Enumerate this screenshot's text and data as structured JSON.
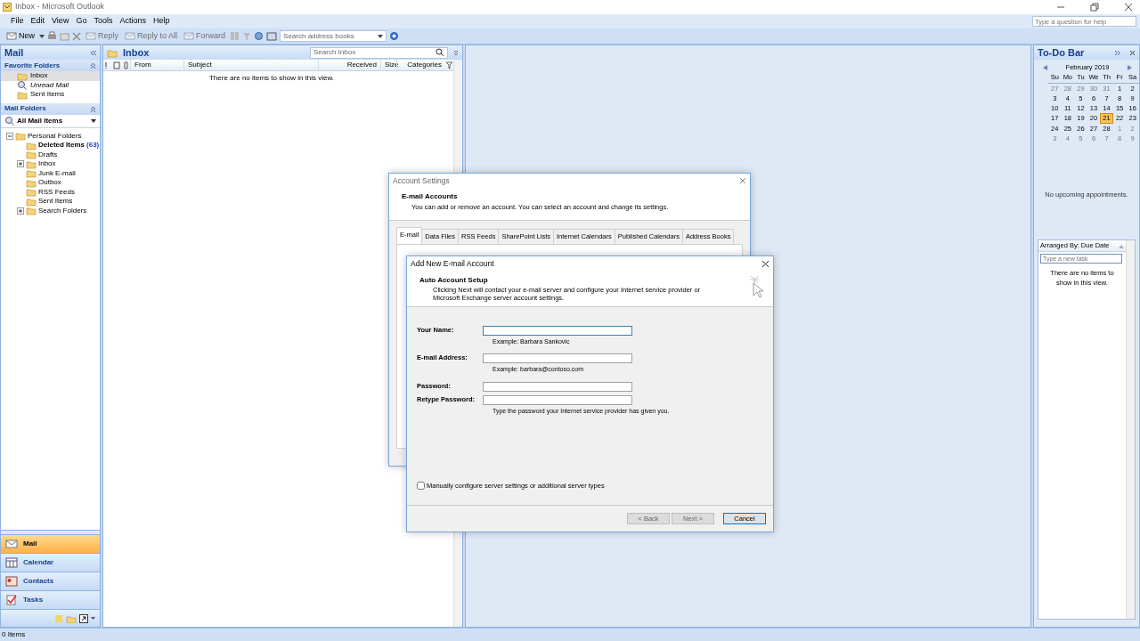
{
  "window": {
    "title": "Inbox - Microsoft Outlook",
    "help_placeholder": "Type a question for help"
  },
  "menu": [
    "File",
    "Edit",
    "View",
    "Go",
    "Tools",
    "Actions",
    "Help"
  ],
  "toolbar": {
    "buttons": [
      {
        "label": "New",
        "disabled": false
      },
      {
        "label": "Reply",
        "disabled": true
      },
      {
        "label": "Reply to All",
        "disabled": true
      },
      {
        "label": "Forward",
        "disabled": true
      }
    ],
    "address_search": "Search address books"
  },
  "nav": {
    "title": "Mail",
    "favorites": {
      "title": "Favorite Folders",
      "items": [
        {
          "label": "Inbox",
          "kind": "folder",
          "selected": true
        },
        {
          "label": "Unread Mail",
          "kind": "search",
          "selected": false
        },
        {
          "label": "Sent Items",
          "kind": "folder",
          "selected": false
        }
      ]
    },
    "mail_folders": {
      "title": "Mail Folders",
      "view": "All Mail Items",
      "tree": [
        {
          "label": "Personal Folders",
          "expanded": true,
          "unread": false,
          "children": [
            {
              "label": "Deleted Items",
              "count": "(63)",
              "unread": true
            },
            {
              "label": "Drafts",
              "unread": false
            },
            {
              "label": "Inbox",
              "expanded": false,
              "unread": false
            },
            {
              "label": "Junk E-mail",
              "unread": false
            },
            {
              "label": "Outbox",
              "unread": false
            },
            {
              "label": "RSS Feeds",
              "unread": false
            },
            {
              "label": "Sent Items",
              "unread": false
            },
            {
              "label": "Search Folders",
              "expanded": false,
              "unread": false
            }
          ]
        }
      ]
    },
    "buttons": [
      {
        "label": "Mail",
        "selected": true
      },
      {
        "label": "Calendar",
        "selected": false
      },
      {
        "label": "Contacts",
        "selected": false
      },
      {
        "label": "Tasks",
        "selected": false
      }
    ]
  },
  "inbox": {
    "title": "Inbox",
    "search_placeholder": "Search Inbox",
    "columns": [
      "From",
      "Subject",
      "Received",
      "Size",
      "Categories"
    ],
    "empty_text": "There are no items to show in this view."
  },
  "todo_bar": {
    "title": "To-Do Bar",
    "calendar": {
      "month": "February 2019",
      "weekdays": [
        "Su",
        "Mo",
        "Tu",
        "We",
        "Th",
        "Fr",
        "Sa"
      ],
      "weeks": [
        [
          {
            "day": "27",
            "other_month": true,
            "selected": false
          },
          {
            "day": "28",
            "other_month": true,
            "selected": false
          },
          {
            "day": "29",
            "other_month": true,
            "selected": false
          },
          {
            "day": "30",
            "other_month": true,
            "selected": false
          },
          {
            "day": "31",
            "other_month": true,
            "selected": false
          },
          {
            "day": "1",
            "other_month": false,
            "selected": false
          },
          {
            "day": "2",
            "other_month": false,
            "selected": false
          }
        ],
        [
          {
            "day": "3",
            "other_month": false,
            "selected": false
          },
          {
            "day": "4",
            "other_month": false,
            "selected": false
          },
          {
            "day": "5",
            "other_month": false,
            "selected": false
          },
          {
            "day": "6",
            "other_month": false,
            "selected": false
          },
          {
            "day": "7",
            "other_month": false,
            "selected": false
          },
          {
            "day": "8",
            "other_month": false,
            "selected": false
          },
          {
            "day": "9",
            "other_month": false,
            "selected": false
          }
        ],
        [
          {
            "day": "10",
            "other_month": false,
            "selected": false
          },
          {
            "day": "11",
            "other_month": false,
            "selected": false
          },
          {
            "day": "12",
            "other_month": false,
            "selected": false
          },
          {
            "day": "13",
            "other_month": false,
            "selected": false
          },
          {
            "day": "14",
            "other_month": false,
            "selected": false
          },
          {
            "day": "15",
            "other_month": false,
            "selected": false
          },
          {
            "day": "16",
            "other_month": false,
            "selected": false
          }
        ],
        [
          {
            "day": "17",
            "other_month": false,
            "selected": false
          },
          {
            "day": "18",
            "other_month": false,
            "selected": false
          },
          {
            "day": "19",
            "other_month": false,
            "selected": false
          },
          {
            "day": "20",
            "other_month": false,
            "selected": false
          },
          {
            "day": "21",
            "other_month": false,
            "selected": true
          },
          {
            "day": "22",
            "other_month": false,
            "selected": false
          },
          {
            "day": "23",
            "other_month": false,
            "selected": false
          }
        ],
        [
          {
            "day": "24",
            "other_month": false,
            "selected": false
          },
          {
            "day": "25",
            "other_month": false,
            "selected": false
          },
          {
            "day": "26",
            "other_month": false,
            "selected": false
          },
          {
            "day": "27",
            "other_month": false,
            "selected": false
          },
          {
            "day": "28",
            "other_month": false,
            "selected": false
          },
          {
            "day": "1",
            "other_month": true,
            "selected": false
          },
          {
            "day": "2",
            "other_month": true,
            "selected": false
          }
        ],
        [
          {
            "day": "3",
            "other_month": true,
            "selected": false
          },
          {
            "day": "4",
            "other_month": true,
            "selected": false
          },
          {
            "day": "5",
            "other_month": true,
            "selected": false
          },
          {
            "day": "6",
            "other_month": true,
            "selected": false
          },
          {
            "day": "7",
            "other_month": true,
            "selected": false
          },
          {
            "day": "8",
            "other_month": true,
            "selected": false
          },
          {
            "day": "9",
            "other_month": true,
            "selected": false
          }
        ]
      ]
    },
    "appointments_text": "No upcoming appointments.",
    "tasks": {
      "arranged": "Arranged By: Due Date",
      "placeholder": "Type a new task",
      "empty_text": "There are no items to show in this view."
    }
  },
  "status_bar": "0 Items",
  "account_settings": {
    "title": "Account Settings",
    "heading": "E-mail Accounts",
    "description": "You can add or remove an account. You can select an account and change its settings.",
    "tabs": [
      {
        "label": "E-mail",
        "selected": true
      },
      {
        "label": "Data Files",
        "selected": false
      },
      {
        "label": "RSS Feeds",
        "selected": false
      },
      {
        "label": "SharePoint Lists",
        "selected": false
      },
      {
        "label": "Internet Calendars",
        "selected": false
      },
      {
        "label": "Published Calendars",
        "selected": false
      },
      {
        "label": "Address Books",
        "selected": false
      }
    ]
  },
  "add_account": {
    "title": "Add New E-mail Account",
    "heading": "Auto Account Setup",
    "description": "Clicking Next will contact your e-mail server and configure your Internet service provider or Microsoft Exchange server account settings.",
    "fields": [
      {
        "label": "Your Name:",
        "hint": "Example: Barbara Sankovic",
        "focused": true
      },
      {
        "label": "E-mail Address:",
        "hint": "Example: barbara@contoso.com",
        "focused": false
      },
      {
        "label": "Password:",
        "focused": false
      },
      {
        "label": "Retype Password:",
        "hint": "Type the password your Internet service provider has given you.",
        "focused": false
      }
    ],
    "checkbox": {
      "label": "Manually configure server settings or additional server types",
      "checked": false
    },
    "buttons": [
      {
        "label": "< Back",
        "disabled": true
      },
      {
        "label": "Next >",
        "disabled": true
      },
      {
        "label": "Cancel",
        "disabled": false
      }
    ]
  }
}
